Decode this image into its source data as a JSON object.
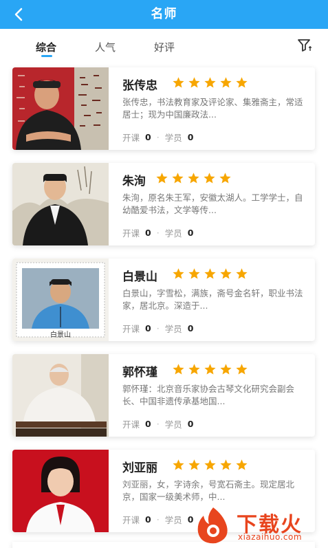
{
  "header": {
    "title": "名师"
  },
  "tabs": [
    {
      "label": "综合",
      "active": true
    },
    {
      "label": "人气",
      "active": false
    },
    {
      "label": "好评",
      "active": false
    }
  ],
  "colors": {
    "accent": "#29a6f5",
    "star": "#f7a600"
  },
  "teachers": [
    {
      "name": "张传忠",
      "rating": 5,
      "desc": "张传忠，书法教育家及评论家、集雅斋主，常适居士；现为中国廉政法...",
      "lessons_label": "开课",
      "lessons": "0",
      "students_label": "学员",
      "students": "0"
    },
    {
      "name": "朱洵",
      "rating": 5,
      "desc": "朱洵，原名朱王军，安徽太湖人。工学学士，自幼酷爱书法，文学等传...",
      "lessons_label": "开课",
      "lessons": "0",
      "students_label": "学员",
      "students": "0"
    },
    {
      "name": "白景山",
      "rating": 5,
      "desc": "白景山，字雪松，满族，斋号金名轩，职业书法家，居北京。深造于...",
      "lessons_label": "开课",
      "lessons": "0",
      "students_label": "学员",
      "students": "0",
      "photo_caption": "白景山"
    },
    {
      "name": "郭怀瑾",
      "rating": 5,
      "desc": "郭怀瑾：北京音乐家协会古琴文化研究会副会长、中国非遗传承基地国...",
      "lessons_label": "开课",
      "lessons": "0",
      "students_label": "学员",
      "students": "0"
    },
    {
      "name": "刘亚丽",
      "rating": 5,
      "desc": "刘亚丽，女，字诗余，号宽石斋主。现定居北京，国家一级美术师，中...",
      "lessons_label": "开课",
      "lessons": "0",
      "students_label": "学员",
      "students": "0"
    }
  ],
  "watermark": {
    "text": "下载火",
    "url": "xiazaihuo.com"
  }
}
